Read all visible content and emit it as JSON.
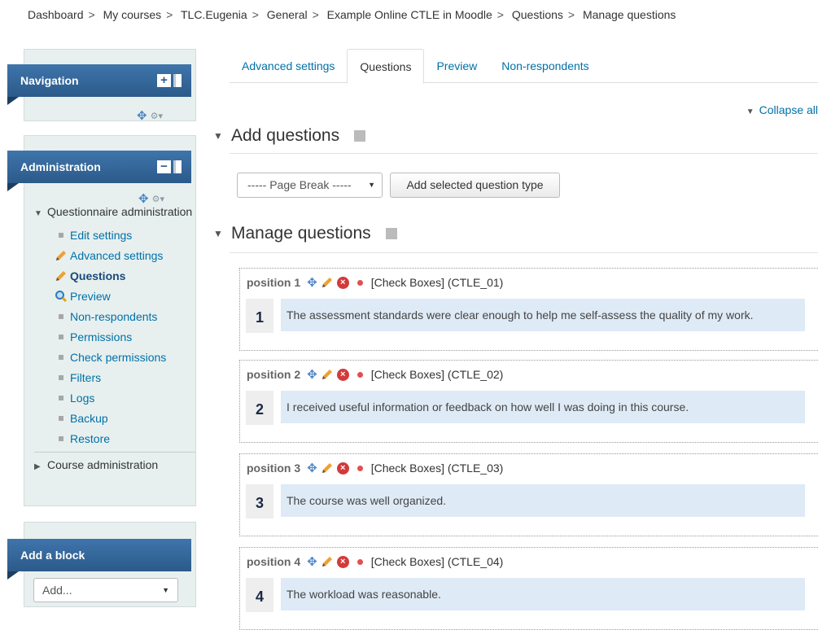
{
  "breadcrumb": [
    "Dashboard",
    "My courses",
    "TLC.Eugenia",
    "General",
    "Example Online CTLE in Moodle",
    "Questions",
    "Manage questions"
  ],
  "breadcrumb_separator": ">",
  "blocks": {
    "navigation": {
      "title": "Navigation",
      "expand_symbol": "+"
    },
    "administration": {
      "title": "Administration",
      "collapse_symbol": "−",
      "group_label": "Questionnaire administration",
      "items": [
        {
          "label": "Edit settings",
          "icon": "bullet"
        },
        {
          "label": "Advanced settings",
          "icon": "pencil-icon"
        },
        {
          "label": "Questions",
          "icon": "pencil-icon",
          "active": true
        },
        {
          "label": "Preview",
          "icon": "magnifier-icon"
        },
        {
          "label": "Non-respondents",
          "icon": "bullet"
        },
        {
          "label": "Permissions",
          "icon": "bullet"
        },
        {
          "label": "Check permissions",
          "icon": "bullet"
        },
        {
          "label": "Filters",
          "icon": "bullet"
        },
        {
          "label": "Logs",
          "icon": "bullet"
        },
        {
          "label": "Backup",
          "icon": "bullet"
        },
        {
          "label": "Restore",
          "icon": "bullet"
        }
      ],
      "course_admin_label": "Course administration"
    },
    "add_block": {
      "title": "Add a block",
      "select_value": "Add..."
    }
  },
  "tabs": [
    {
      "label": "Advanced settings",
      "active": false
    },
    {
      "label": "Questions",
      "active": true
    },
    {
      "label": "Preview",
      "active": false
    },
    {
      "label": "Non-respondents",
      "active": false
    }
  ],
  "collapse_all": "Collapse all",
  "add_questions": {
    "title": "Add questions",
    "select_value": "----- Page Break -----",
    "button_label": "Add selected question type"
  },
  "manage_questions": {
    "title": "Manage questions",
    "questions": [
      {
        "position": "position 1",
        "type": "[Check Boxes] (CTLE_01)",
        "number": "1",
        "text": "The assessment standards were clear enough to help me self-assess the quality of my work."
      },
      {
        "position": "position 2",
        "type": "[Check Boxes] (CTLE_02)",
        "number": "2",
        "text": "I received useful information or feedback on how well I was doing in this course."
      },
      {
        "position": "position 3",
        "type": "[Check Boxes] (CTLE_03)",
        "number": "3",
        "text": "The course was well organized."
      },
      {
        "position": "position 4",
        "type": "[Check Boxes] (CTLE_04)",
        "number": "4",
        "text": "The workload was reasonable."
      }
    ]
  },
  "colors": {
    "block_header": "#2b5a8a",
    "block_bg": "#e7f0ef",
    "link": "#0070a8",
    "question_text_bg": "#deeaf6"
  }
}
